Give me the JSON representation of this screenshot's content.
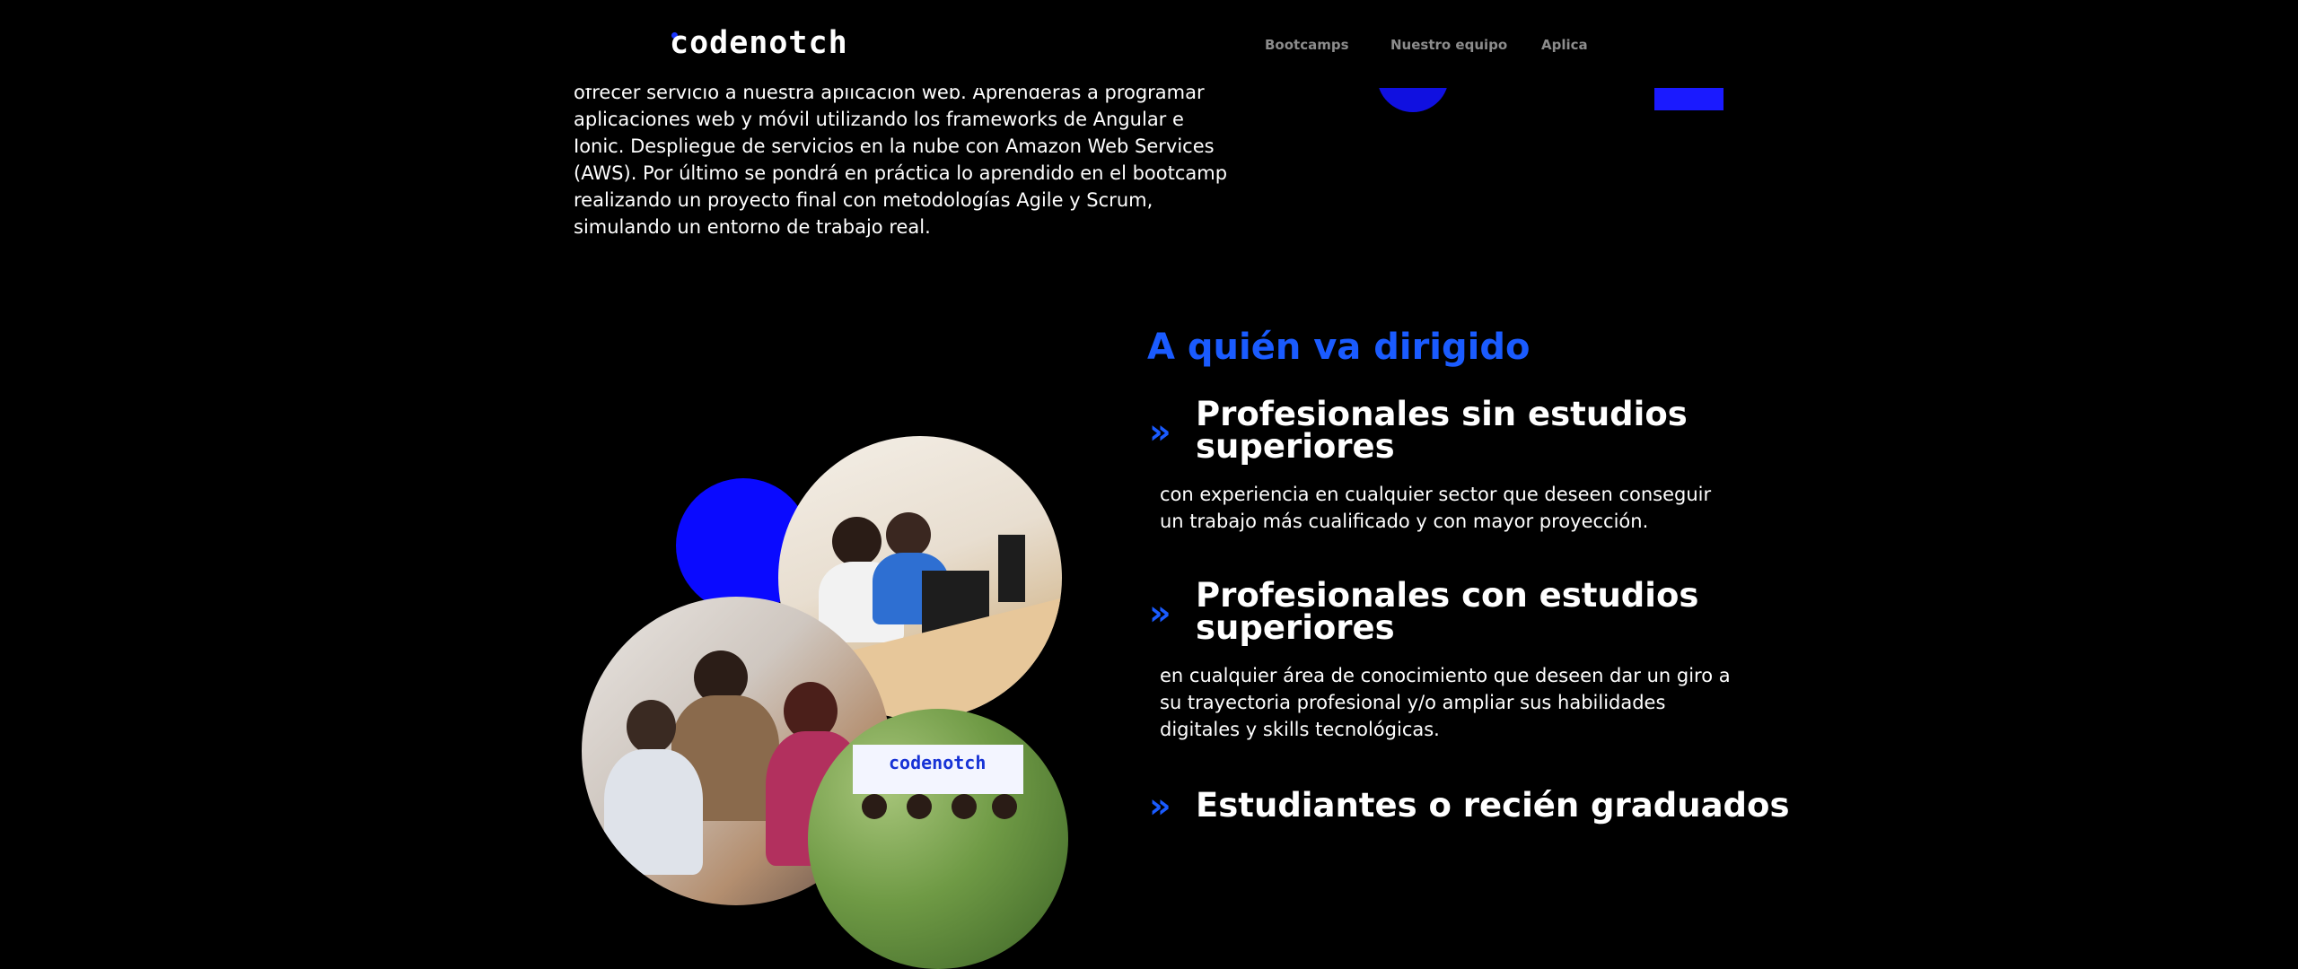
{
  "header": {
    "logo_text": "codenotch",
    "nav": [
      "Bootcamps",
      "Nuestro equipo",
      "Aplica"
    ]
  },
  "intro": {
    "paragraph": "ofrecer servicio a nuestra aplicación web. Aprenderás a programar aplicaciones web y móvil utilizando los frameworks de Angular e Ionic. Despliegue de servicios en la nube con Amazon Web Services (AWS). Por último se pondrá en práctica lo aprendido en el bootcamp realizando un proyecto final con metodologías Agile y Scrum, simulando un entorno de trabajo real."
  },
  "audience": {
    "title": "A quién va dirigido",
    "items": [
      {
        "title": "Profesionales sin estudios superiores",
        "description": "con experiencia en cualquier sector que deseen conseguir un trabajo más cualificado y con mayor proyección."
      },
      {
        "title": "Profesionales con estudios superiores",
        "description": "en cualquier área de conocimiento que deseen dar un giro a su trayectoria profesional y/o ampliar sus habilidades digitales y skills tecnológicas."
      },
      {
        "title": "Estudiantes o recién graduados",
        "description": ""
      }
    ],
    "photo_wall_logo": "codenotch"
  },
  "colors": {
    "accent": "#1a5bff",
    "deco_blue": "#0a0aff",
    "background": "#000000",
    "nav_text": "#8c8c8c"
  },
  "icons": {
    "list_marker": "chevron-double-right-icon"
  }
}
